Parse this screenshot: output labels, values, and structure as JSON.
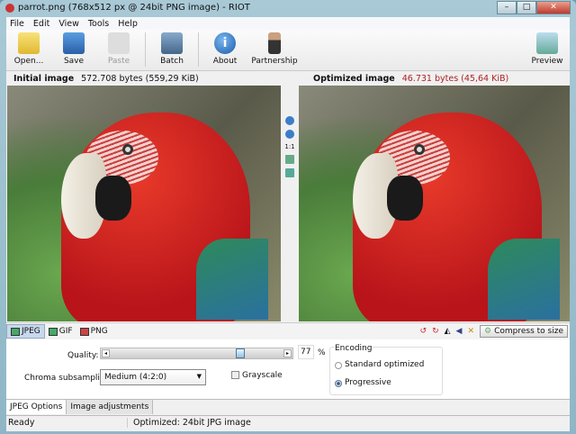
{
  "window": {
    "title": "parrot.png (768x512 px @ 24bit PNG image) - RIOT",
    "minimize": "–",
    "maximize": "□",
    "close": "✕"
  },
  "menu": [
    "File",
    "Edit",
    "View",
    "Tools",
    "Help"
  ],
  "toolbar": {
    "open": "Open...",
    "save": "Save",
    "paste": "Paste",
    "batch": "Batch",
    "about": "About",
    "partnership": "Partnership",
    "preview": "Preview"
  },
  "initial": {
    "label": "Initial image",
    "size": "572.708 bytes (559,29 KiB)"
  },
  "optimized": {
    "label": "Optimized image",
    "size": "46.731 bytes (45,64 KiB)",
    "size_color": "#b02020"
  },
  "zoom_strip": {
    "actual": "1:1"
  },
  "formats": {
    "tabs": [
      "JPEG",
      "GIF",
      "PNG"
    ],
    "selected": "JPEG",
    "compress": "Compress to size"
  },
  "jpeg": {
    "quality_label": "Quality:",
    "quality": 77,
    "quality_unit": "%",
    "chroma_label": "Chroma subsampling:",
    "chroma_value": "Medium (4:2:0)",
    "grayscale_label": "Grayscale",
    "grayscale": false,
    "encoding_label": "Encoding",
    "encoding_options": [
      "Standard optimized",
      "Progressive"
    ],
    "encoding_selected": "Progressive"
  },
  "bottom_tabs": [
    "JPEG Options",
    "Image adjustments"
  ],
  "status": {
    "left": "Ready",
    "right": "Optimized: 24bit JPG image"
  }
}
